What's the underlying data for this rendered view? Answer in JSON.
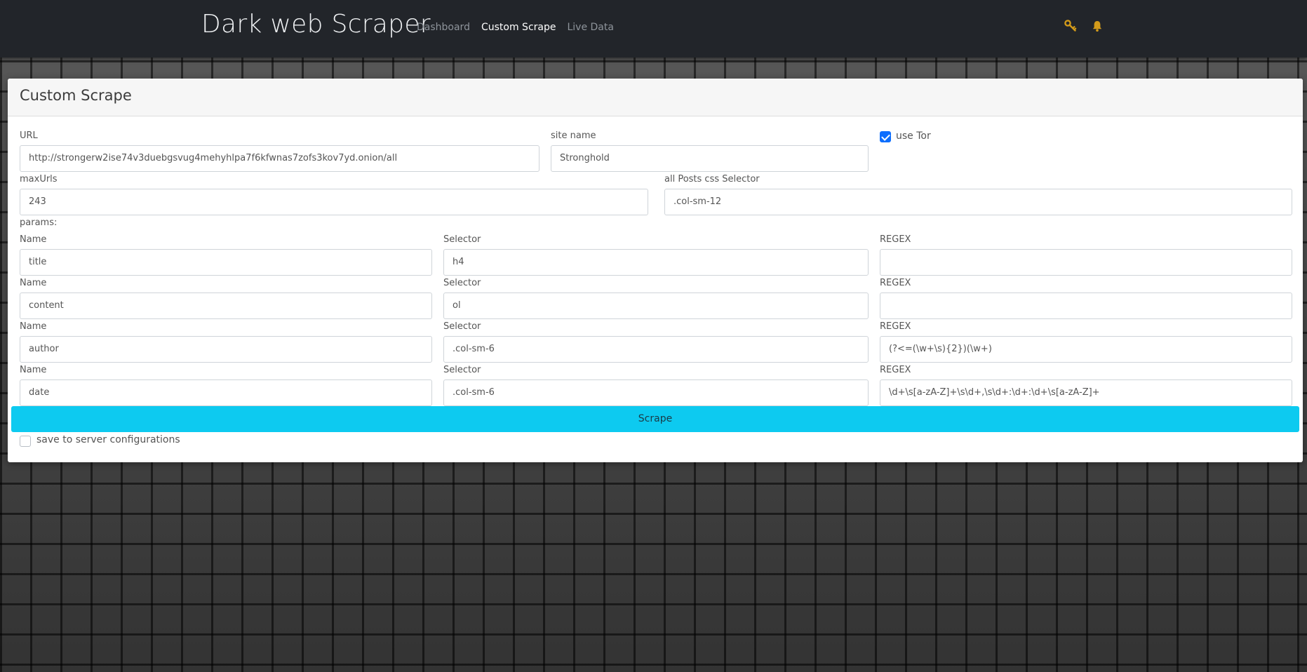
{
  "app": {
    "title": "Dark web Scraper"
  },
  "nav": {
    "links": [
      {
        "label": "Dashboard",
        "active": false
      },
      {
        "label": "Custom Scrape",
        "active": true
      },
      {
        "label": "Live Data",
        "active": false
      }
    ],
    "icons": [
      "key-icon",
      "bell-icon"
    ],
    "icon_color": "#d39b1a"
  },
  "card": {
    "title": "Custom Scrape",
    "url": {
      "label": "URL",
      "value": "http://strongerw2ise74v3duebgsvug4mehyhlpa7f6kfwnas7zofs3kov7yd.onion/all"
    },
    "site_name": {
      "label": "site name",
      "value": "Stronghold"
    },
    "use_tor": {
      "label": "use Tor",
      "checked": true
    },
    "max_urls": {
      "label": "maxUrls",
      "value": "243"
    },
    "posts_selector": {
      "label": "all Posts css Selector",
      "value": ".col-sm-12"
    },
    "params_label": "params:",
    "params": [
      {
        "name_label": "Name",
        "name": "title",
        "selector_label": "Selector",
        "selector": "h4",
        "regex_label": "REGEX",
        "regex": ""
      },
      {
        "name_label": "Name",
        "name": "content",
        "selector_label": "Selector",
        "selector": "ol",
        "regex_label": "REGEX",
        "regex": ""
      },
      {
        "name_label": "Name",
        "name": "author",
        "selector_label": "Selector",
        "selector": ".col-sm-6",
        "regex_label": "REGEX",
        "regex": "(?<=(\\w+\\s){2})(\\w+)"
      },
      {
        "name_label": "Name",
        "name": "date",
        "selector_label": "Selector",
        "selector": ".col-sm-6",
        "regex_label": "REGEX",
        "regex": "\\d+\\s[a-zA-Z]+\\s\\d+,\\s\\d+:\\d+:\\d+\\s[a-zA-Z]+"
      }
    ],
    "scrape_button": "Scrape",
    "save_config": {
      "label": "save to server configurations",
      "checked": false
    }
  },
  "colors": {
    "navbar": "#22252a",
    "scrape_button": "#0dcaf0",
    "checkbox_checked": "#0d6efd"
  }
}
